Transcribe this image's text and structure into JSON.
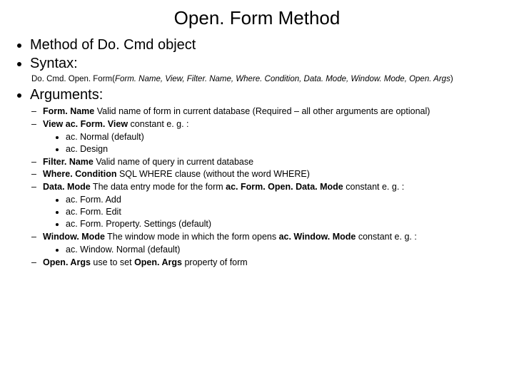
{
  "title": "Open. Form Method",
  "top": {
    "item1": "Method of Do. Cmd object",
    "item2": "Syntax:",
    "item3": "Arguments:"
  },
  "syntax": {
    "prefix": "Do. Cmd. Open. Form(",
    "args": "Form. Name, View, Filter. Name, Where. Condition, Data. Mode, Window. Mode, Open. Args",
    "suffix": ")"
  },
  "args": {
    "formname": {
      "label": "Form. Name",
      "text": " Valid name of form in current database (Required – all other arguments are optional)"
    },
    "view": {
      "label": "View",
      "pre": " ",
      "bold2": "ac. Form. View",
      "post": " constant e. g. :"
    },
    "viewsub": {
      "a": "ac. Normal (default)",
      "b": "ac. Design"
    },
    "filtername": {
      "label": "Filter. Name",
      "text": " Valid name of query in current database"
    },
    "wherecond": {
      "label": "Where. Condition",
      "text": " SQL WHERE clause (without the word WHERE)"
    },
    "datamode": {
      "label": "Data. Mode",
      "text1": " The data entry mode for the form ",
      "bold2": "ac. Form. Open. Data. Mode",
      "text2": " constant e. g. :"
    },
    "datamodesub": {
      "a": "ac. Form. Add",
      "b": "ac. Form. Edit",
      "c": "ac. Form. Property. Settings (default)"
    },
    "windowmode": {
      "label": "Window. Mode",
      "text1": " The window mode in which the form opens ",
      "bold2": "ac. Window. Mode",
      "text2": " constant e. g. :"
    },
    "windowmodesub": {
      "a": "ac. Window. Normal (default)"
    },
    "openargs": {
      "label": "Open. Args",
      "text1": " use to set ",
      "bold2": "Open. Args",
      "text2": " property of form"
    }
  }
}
